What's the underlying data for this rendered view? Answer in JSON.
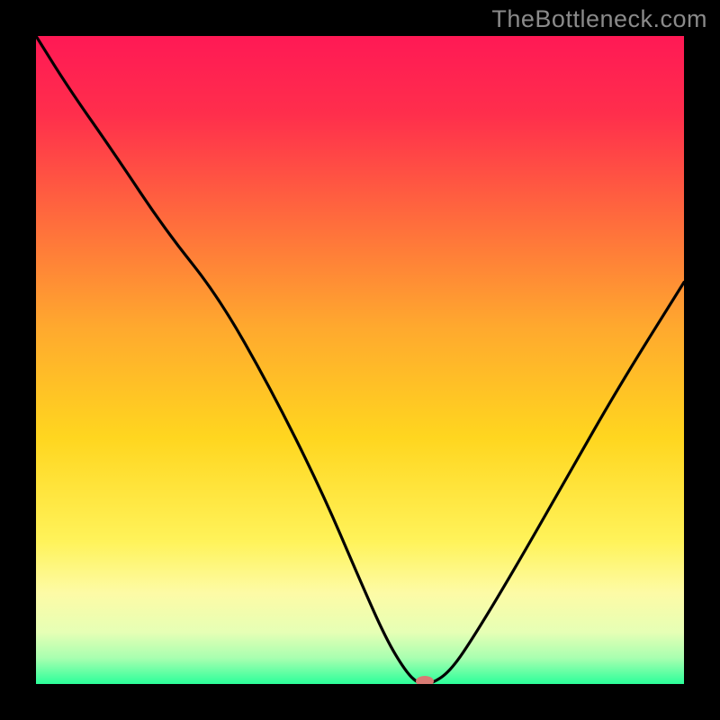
{
  "watermark": "TheBottleneck.com",
  "chart_data": {
    "type": "line",
    "title": "",
    "xlabel": "",
    "ylabel": "",
    "xlim": [
      0,
      100
    ],
    "ylim": [
      0,
      100
    ],
    "grid": false,
    "legend": false,
    "background_gradient": {
      "stops": [
        {
          "offset": 0.0,
          "color": "#ff1955"
        },
        {
          "offset": 0.12,
          "color": "#ff2e4c"
        },
        {
          "offset": 0.28,
          "color": "#ff6a3d"
        },
        {
          "offset": 0.45,
          "color": "#ffa92e"
        },
        {
          "offset": 0.62,
          "color": "#ffd61f"
        },
        {
          "offset": 0.78,
          "color": "#fff35a"
        },
        {
          "offset": 0.86,
          "color": "#fdfba6"
        },
        {
          "offset": 0.92,
          "color": "#e6ffb5"
        },
        {
          "offset": 0.96,
          "color": "#a8ffb0"
        },
        {
          "offset": 1.0,
          "color": "#2bff9a"
        }
      ]
    },
    "series": [
      {
        "name": "bottleneck-curve",
        "x": [
          0,
          5,
          12,
          20,
          28,
          36,
          44,
          50,
          54,
          57,
          59,
          61,
          64,
          68,
          74,
          82,
          90,
          100
        ],
        "y": [
          100,
          92,
          82,
          70,
          60,
          46,
          30,
          16,
          7,
          2,
          0,
          0,
          2,
          8,
          18,
          32,
          46,
          62
        ]
      }
    ],
    "marker": {
      "name": "optimum-marker",
      "x": 60,
      "y": 0,
      "color": "#d97b74",
      "rx": 10,
      "ry": 6
    }
  }
}
